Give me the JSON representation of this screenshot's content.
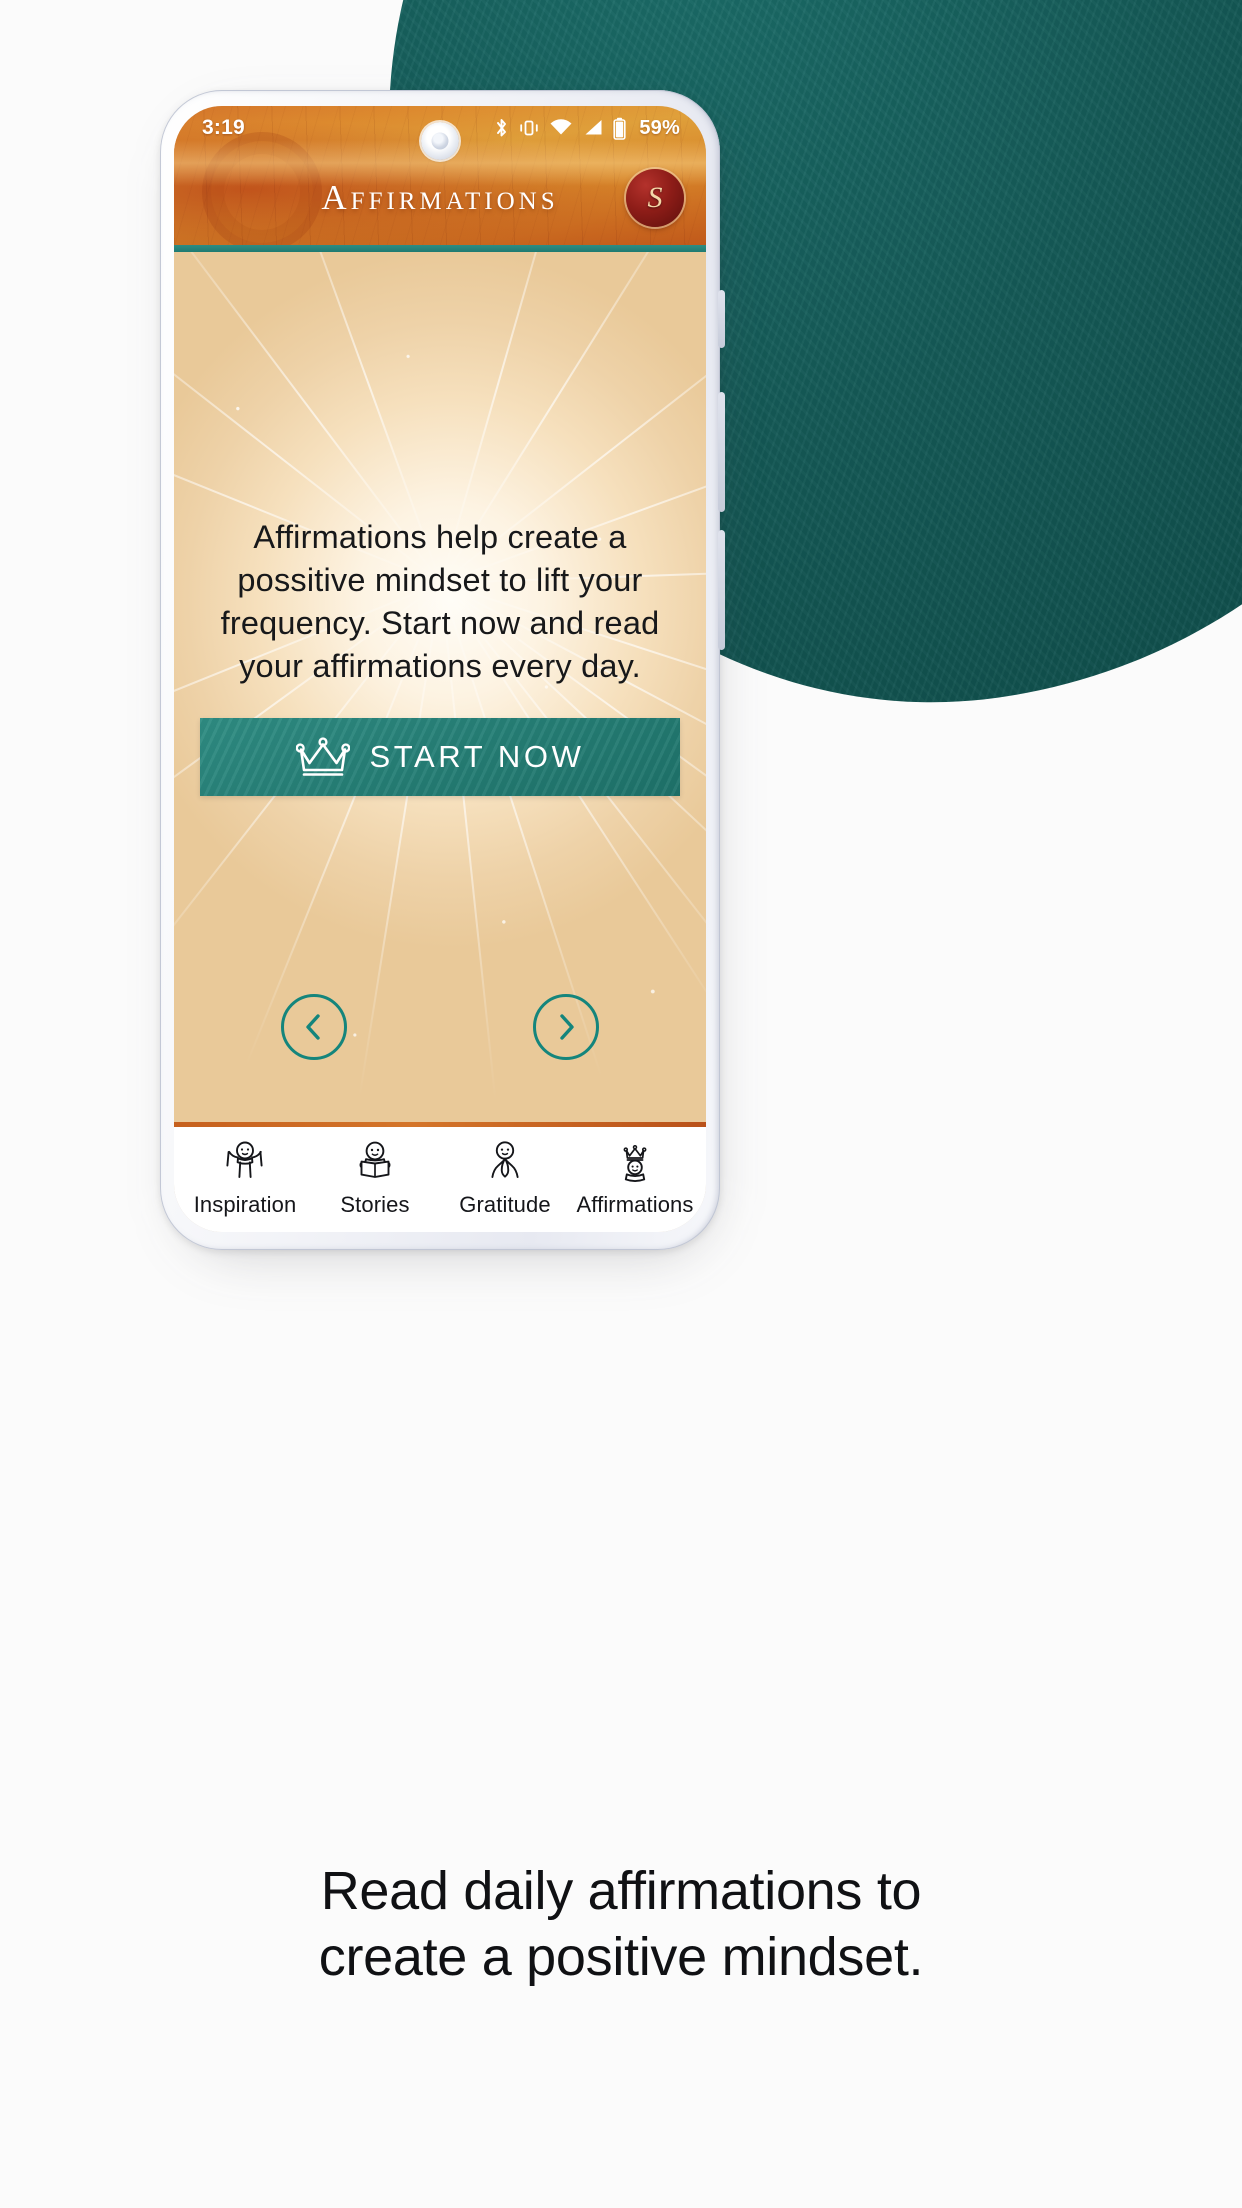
{
  "theme": {
    "teal": "#1d6f6b",
    "teal_button": "#26807f",
    "teal_accent": "#14857c",
    "orange_header": "#d4752a",
    "logo_red": "#8e1d18",
    "parchment": "#f6e0bd"
  },
  "status_bar": {
    "time": "3:19",
    "battery_percent": "59%",
    "icons": [
      "bluetooth-icon",
      "vibrate-icon",
      "wifi-icon",
      "cellular-signal-icon",
      "battery-icon"
    ]
  },
  "app_bar": {
    "title": "Affirmations",
    "logo_letter": "S",
    "logo_name": "app-logo-badge"
  },
  "main": {
    "blurb": "Affirmations help create a possitive mindset to lift your frequency. Start now and read your affirmations every day.",
    "start_button": {
      "label": "START NOW",
      "icon": "crown-icon"
    },
    "prev_button": {
      "icon": "chevron-left-icon"
    },
    "next_button": {
      "icon": "chevron-right-icon"
    }
  },
  "bottom_nav": {
    "items": [
      {
        "label": "Inspiration",
        "icon": "person-arms-raised-icon",
        "active": false
      },
      {
        "label": "Stories",
        "icon": "person-reading-book-icon",
        "active": false
      },
      {
        "label": "Gratitude",
        "icon": "person-praying-icon",
        "active": false
      },
      {
        "label": "Affirmations",
        "icon": "person-crown-icon",
        "active": true
      }
    ]
  },
  "caption": {
    "line1": "Read daily affirmations to",
    "line2": "create a positive mindset."
  }
}
